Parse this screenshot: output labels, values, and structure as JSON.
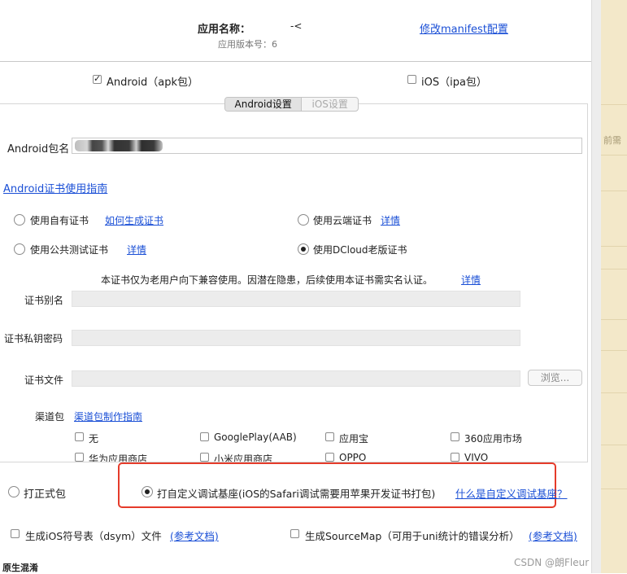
{
  "header": {
    "app_name_label": "应用名称：",
    "app_name_value": "-<",
    "version_label": "应用版本号：6",
    "manifest_link": "修改manifest配置"
  },
  "platforms": {
    "android": {
      "label": "Android（apk包）",
      "checked": true
    },
    "ios": {
      "label": "iOS（ipa包）",
      "checked": false
    }
  },
  "tabs": [
    {
      "label": "Android设置",
      "active": true
    },
    {
      "label": "iOS设置",
      "active": false
    }
  ],
  "package": {
    "label": "Android包名"
  },
  "cert_guide_link": "Android证书使用指南",
  "cert_options": [
    {
      "label": "使用自有证书",
      "link": "如何生成证书",
      "selected": false
    },
    {
      "label": "使用云端证书",
      "link": "详情",
      "selected": false
    },
    {
      "label": "使用公共测试证书",
      "link": "详情",
      "selected": false
    },
    {
      "label": "使用DCloud老版证书",
      "link": "",
      "selected": true
    }
  ],
  "notice": {
    "text": "本证书仅为老用户向下兼容使用。因潜在隐患，后续使用本证书需实名认证。",
    "link": "详情"
  },
  "cert_fields": {
    "alias_label": "证书别名",
    "password_label": "证书私钥密码",
    "file_label": "证书文件",
    "browse_button": "浏览..."
  },
  "channel": {
    "label": "渠道包",
    "link": "渠道包制作指南",
    "items": [
      "无",
      "GooglePlay(AAB)",
      "应用宝",
      "360应用市场",
      "华为应用商店",
      "小米应用商店",
      "OPPO",
      "VIVO"
    ]
  },
  "package_type": {
    "formal": {
      "label": "打正式包",
      "selected": false
    },
    "custom": {
      "label": "打自定义调试基座(iOS的Safari调试需要用苹果开发证书打包)",
      "selected": true
    },
    "custom_link": "什么是自定义调试基座？"
  },
  "extras": {
    "ios_symbols": {
      "label": "生成iOS符号表（dsym）文件",
      "link": "(参考文档)"
    },
    "sourcemap": {
      "label": "生成SourceMap（可用于uni统计的错误分析）",
      "link": "(参考文档)"
    }
  },
  "footer_label": "原生混淆",
  "side_text": "前需",
  "watermark": "CSDN @朗Fleur",
  "colors": {
    "link": "#1a4fd6",
    "highlight": "#e53b2a",
    "side_panel": "#f3e8c9"
  }
}
